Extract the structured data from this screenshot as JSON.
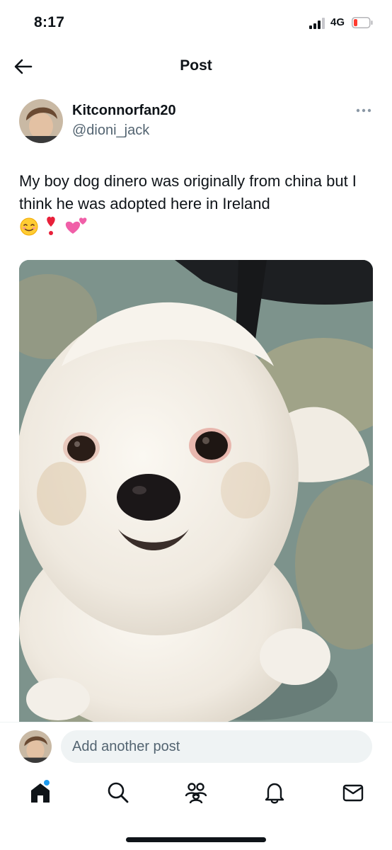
{
  "status_bar": {
    "time": "8:17",
    "network": "4G"
  },
  "header": {
    "title": "Post",
    "back_icon": "arrow-left-icon"
  },
  "post": {
    "author": {
      "display_name": "Kitconnorfan20",
      "handle": "@dioni_jack"
    },
    "text": "My boy dog dinero was originally from china but I think he was adopted here in Ireland",
    "emojis": [
      "smiling-face-emoji",
      "exclamation-heart-emoji",
      "two-hearts-emoji"
    ],
    "media": "photo of white fluffy dog"
  },
  "reply": {
    "placeholder": "Add another post"
  },
  "bottom_nav": {
    "items": [
      "home-icon",
      "search-icon",
      "communities-icon",
      "notifications-icon",
      "messages-icon"
    ],
    "active": "home-icon"
  },
  "colors": {
    "accent": "#1d9bf0",
    "text": "#0f1419",
    "secondary": "#536471",
    "surface": "#eff3f4"
  }
}
